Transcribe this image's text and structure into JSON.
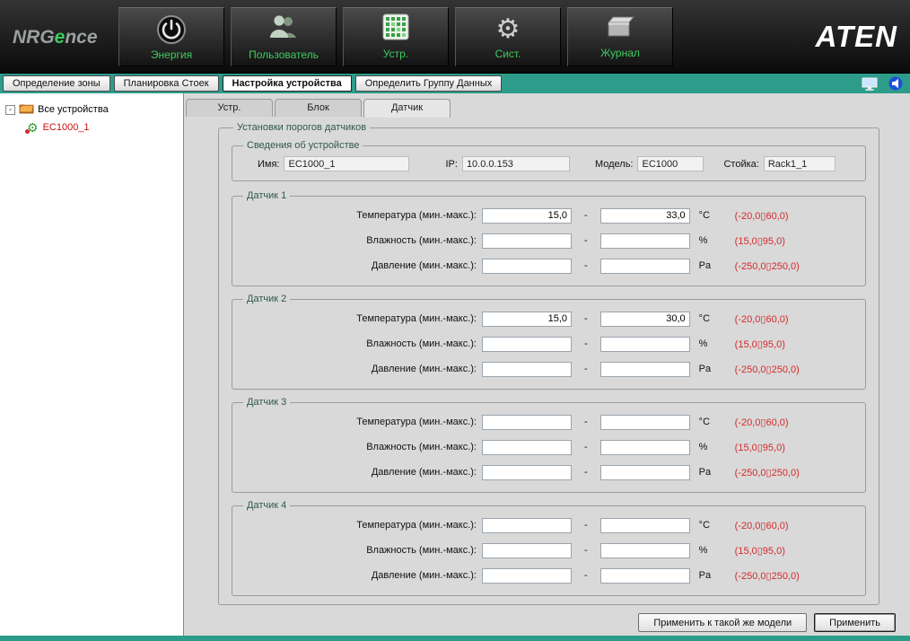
{
  "brand": {
    "prefix": "NRG",
    "accent": "e",
    "suffix": "nce"
  },
  "aten_logo": "ATEN",
  "icons": {
    "gear": "⚙",
    "collapse": "-"
  },
  "top_nav": {
    "items": [
      {
        "label": "Энергия",
        "icon": "power-icon"
      },
      {
        "label": "Пользователь",
        "icon": "users-icon"
      },
      {
        "label": "Устр.",
        "icon": "device-grid-icon"
      },
      {
        "label": "Сист.",
        "icon": "gear-icon"
      },
      {
        "label": "Журнал",
        "icon": "journal-folder-icon"
      }
    ]
  },
  "toolbar": {
    "buttons": [
      {
        "label": "Определение зоны"
      },
      {
        "label": "Планировка Стоек"
      },
      {
        "label": "Настройка устройства"
      },
      {
        "label": "Определить Группу Данных"
      }
    ],
    "active": "Настройка устройства"
  },
  "sidebar": {
    "root_label": "Все устройства",
    "device_label": "EC1000_1"
  },
  "content_tabs": [
    {
      "label": "Устр."
    },
    {
      "label": "Блок"
    },
    {
      "label": "Датчик"
    }
  ],
  "panel": {
    "title": "Установки порогов датчиков",
    "device_info": {
      "title": "Сведения об устройстве",
      "name_label": "Имя:",
      "name_value": "EC1000_1",
      "ip_label": "IP:",
      "ip_value": "10.0.0.153",
      "model_label": "Модель:",
      "model_value": "EC1000",
      "rack_label": "Стойка:",
      "rack_value": "Rack1_1"
    },
    "row_labels": {
      "temperature": "Температура (мин.-макс.):",
      "humidity": "Влажность (мин.-макс.):",
      "pressure": "Давление (мин.-макс.):"
    },
    "dash": "-",
    "units": {
      "temperature": "°C",
      "humidity": "%",
      "pressure": "Pa"
    },
    "ranges": {
      "temperature": "(-20,0▯60,0)",
      "humidity": "(15,0▯95,0)",
      "pressure": "(-250,0▯250,0)"
    },
    "sensors": [
      {
        "title": "Датчик 1",
        "temp_min": "15,0",
        "temp_max": "33,0",
        "hum_min": "",
        "hum_max": "",
        "pres_min": "",
        "pres_max": ""
      },
      {
        "title": "Датчик 2",
        "temp_min": "15,0",
        "temp_max": "30,0",
        "hum_min": "",
        "hum_max": "",
        "pres_min": "",
        "pres_max": ""
      },
      {
        "title": "Датчик 3",
        "temp_min": "",
        "temp_max": "",
        "hum_min": "",
        "hum_max": "",
        "pres_min": "",
        "pres_max": ""
      },
      {
        "title": "Датчик 4",
        "temp_min": "",
        "temp_max": "",
        "hum_min": "",
        "hum_max": "",
        "pres_min": "",
        "pres_max": ""
      }
    ],
    "apply_same_label": "Применить к такой же модели",
    "apply_label": "Применить"
  }
}
